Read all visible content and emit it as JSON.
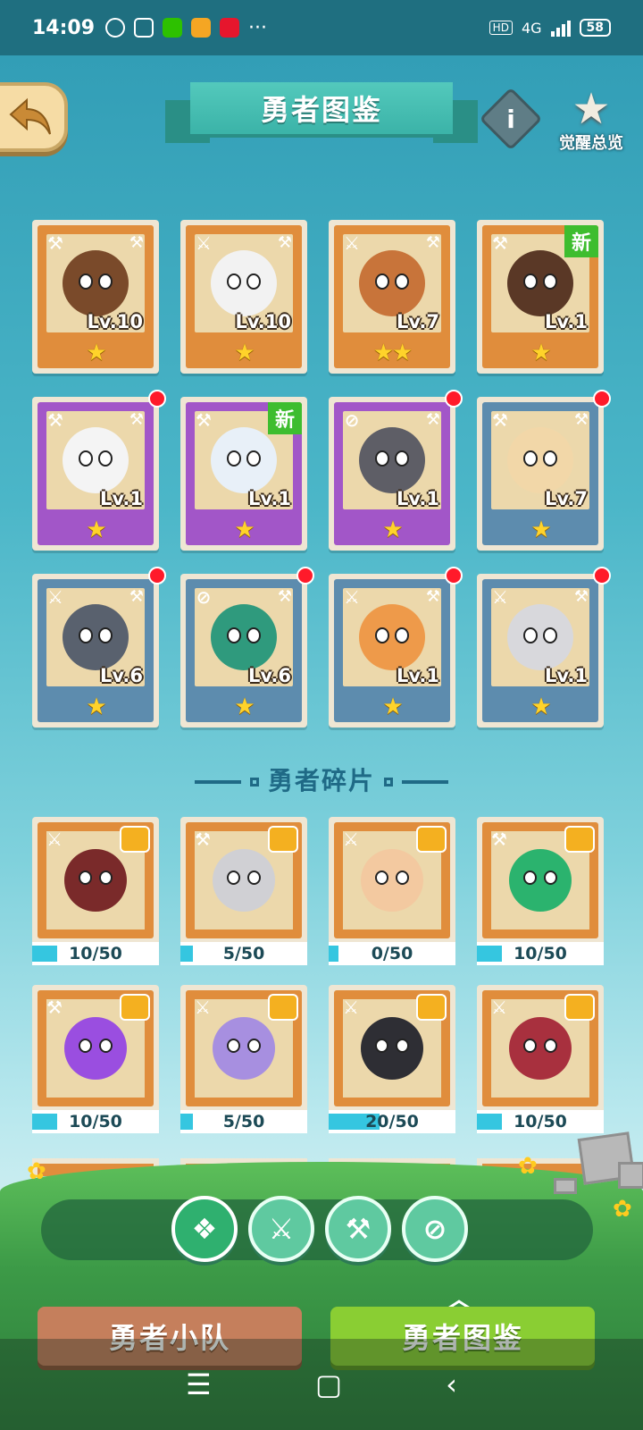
{
  "status_bar": {
    "time": "14:09",
    "network": "4G",
    "hd": "HD",
    "battery": "58",
    "dots": "···"
  },
  "header": {
    "title": "勇者图鉴",
    "info_label": "i",
    "awaken_label": "觉醒总览"
  },
  "heroes": [
    {
      "level": "Lv.10",
      "stars": "★",
      "rarity": "orange",
      "class": "hammer",
      "new": false,
      "dot": false,
      "color": "#7a4a2a"
    },
    {
      "level": "Lv.10",
      "stars": "★",
      "rarity": "orange",
      "class": "sword",
      "new": false,
      "dot": false,
      "color": "#f2f2f2"
    },
    {
      "level": "Lv.7",
      "stars": "★★",
      "rarity": "orange",
      "class": "sword",
      "new": false,
      "dot": false,
      "color": "#c8743a"
    },
    {
      "level": "Lv.1",
      "stars": "★",
      "rarity": "orange",
      "class": "hammer",
      "new": true,
      "dot": false,
      "color": "#5a3826"
    },
    {
      "level": "Lv.1",
      "stars": "★",
      "rarity": "purple",
      "class": "hammer",
      "new": false,
      "dot": true,
      "color": "#f4f4f4"
    },
    {
      "level": "Lv.1",
      "stars": "★",
      "rarity": "purple",
      "class": "hammer",
      "new": true,
      "dot": false,
      "color": "#e8f0f8"
    },
    {
      "level": "Lv.1",
      "stars": "★",
      "rarity": "purple",
      "class": "compass",
      "new": false,
      "dot": true,
      "color": "#5e5e66"
    },
    {
      "level": "Lv.7",
      "stars": "★",
      "rarity": "blue",
      "class": "hammer",
      "new": false,
      "dot": true,
      "color": "#f2d7a8"
    },
    {
      "level": "Lv.6",
      "stars": "★",
      "rarity": "blue",
      "class": "sword",
      "new": false,
      "dot": true,
      "color": "#59616e"
    },
    {
      "level": "Lv.6",
      "stars": "★",
      "rarity": "blue",
      "class": "compass",
      "new": false,
      "dot": true,
      "color": "#2f9a7d"
    },
    {
      "level": "Lv.1",
      "stars": "★",
      "rarity": "blue",
      "class": "sword",
      "new": false,
      "dot": true,
      "color": "#ee9a4a"
    },
    {
      "level": "Lv.1",
      "stars": "★",
      "rarity": "blue",
      "class": "sword",
      "new": false,
      "dot": true,
      "color": "#d8d8dc"
    }
  ],
  "new_badge": "新",
  "fragments_title": "勇者碎片",
  "fragments": [
    {
      "progress": "10/50",
      "fraction": 0.2,
      "class": "sword",
      "color": "#7a2a2a"
    },
    {
      "progress": "5/50",
      "fraction": 0.1,
      "class": "hammer",
      "color": "#d0d0d4"
    },
    {
      "progress": "0/50",
      "fraction": 0.0,
      "class": "sword",
      "color": "#f3c9a0"
    },
    {
      "progress": "10/50",
      "fraction": 0.2,
      "class": "hammer",
      "color": "#2bb36e"
    },
    {
      "progress": "10/50",
      "fraction": 0.2,
      "class": "hammer",
      "color": "#9a4ee0"
    },
    {
      "progress": "5/50",
      "fraction": 0.1,
      "class": "sword",
      "color": "#a78fe0"
    },
    {
      "progress": "20/50",
      "fraction": 0.4,
      "class": "sword",
      "color": "#2e2e34"
    },
    {
      "progress": "10/50",
      "fraction": 0.2,
      "class": "sword",
      "color": "#a8303e"
    }
  ],
  "filters": [
    {
      "name": "all",
      "glyph": "❖"
    },
    {
      "name": "sword",
      "glyph": "⚔"
    },
    {
      "name": "hammer",
      "glyph": "⚒"
    },
    {
      "name": "compass",
      "glyph": "⊘"
    }
  ],
  "tabs": {
    "squad": "勇者小队",
    "codex": "勇者图鉴",
    "chevron": "︿"
  },
  "nav": {
    "menu": "☰",
    "home": "▢",
    "back": "‹"
  },
  "colors": {
    "orange": "#e08d3c",
    "purple": "#a256c8",
    "blue": "#5d8cae",
    "progress_fill": "#35c6e0",
    "new_badge": "#3ebd2f",
    "notification_dot": "#ff1a2a"
  }
}
